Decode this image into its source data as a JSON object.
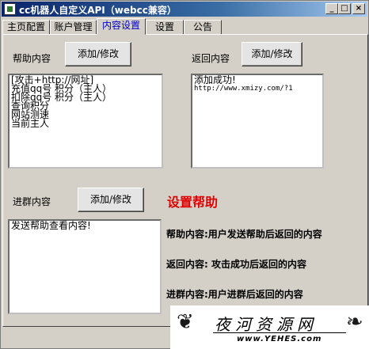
{
  "window": {
    "title": "cc机器人自定义API（webcc兼容）"
  },
  "titlebar_buttons": {
    "minimize": "_",
    "maximize": "□",
    "close": "×"
  },
  "tabs": [
    {
      "label": "主页配置"
    },
    {
      "label": "账户管理"
    },
    {
      "label": "内容设置"
    },
    {
      "label": "设置"
    },
    {
      "label": "公告"
    }
  ],
  "help_section": {
    "label": "帮助内容",
    "button": "添加/修改",
    "lines": [
      "[攻击+http://网址]",
      "充值qq号 积分（主人）",
      "扣除qq号 积分（主人）",
      "查询积分",
      "网站测速",
      "当前主人"
    ]
  },
  "return_section": {
    "label": "返回内容",
    "button": "添加/修改",
    "lines": [
      "添加成功!",
      "http://www.xmizy.com/?1"
    ]
  },
  "join_section": {
    "label": "进群内容",
    "button": "添加/修改",
    "lines": [
      "发送帮助查看内容!"
    ]
  },
  "help_panel": {
    "title": "设置帮助",
    "lines": [
      "帮助内容:用户发送帮助后返回的内容",
      "返回内容: 攻击成功后返回的内容",
      "进群内容:用户进群后返回的内容"
    ]
  },
  "watermark": {
    "text": "夜河资源网",
    "url": "www.YEHES.com"
  },
  "colors": {
    "title_start": "#0a246a",
    "help_title": "#e00000",
    "active_tab_text": "#0000cc"
  }
}
